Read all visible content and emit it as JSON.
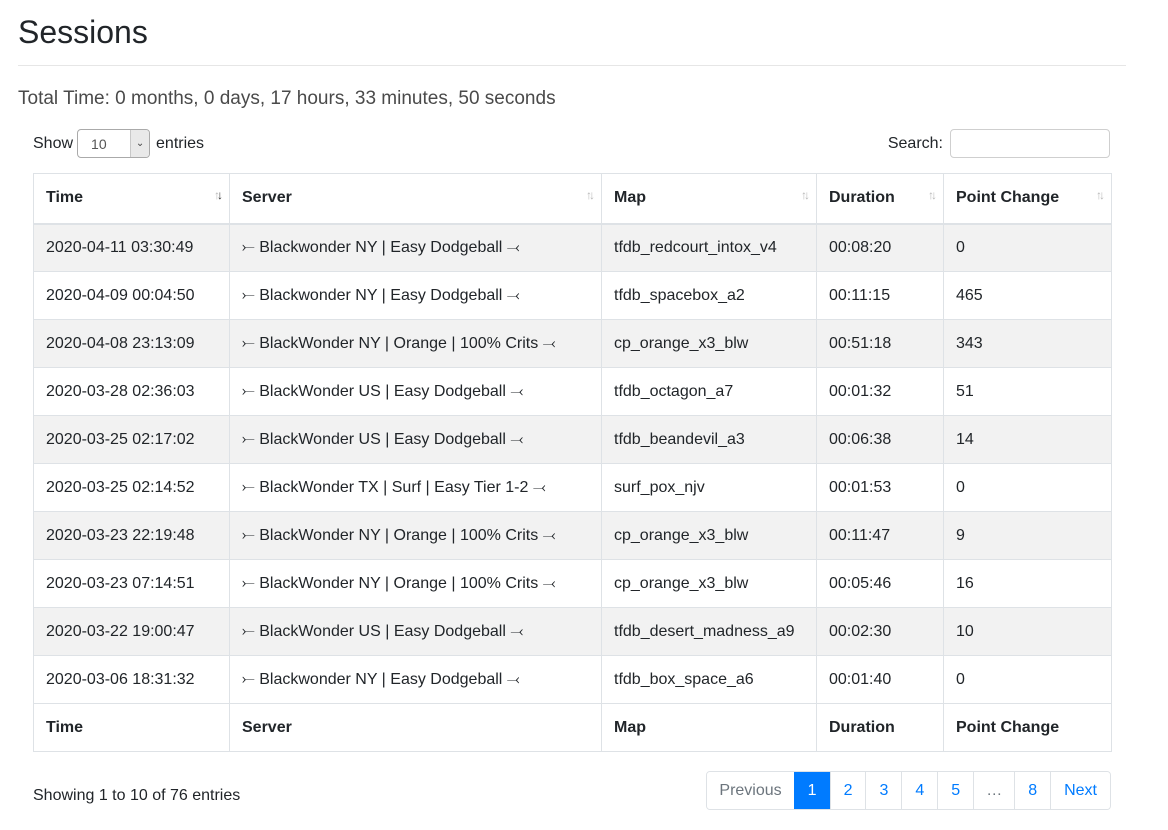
{
  "page": {
    "title": "Sessions",
    "total_time": "Total Time: 0 months, 0 days, 17 hours, 33 minutes, 50 seconds"
  },
  "length": {
    "show_label": "Show",
    "value": "10",
    "entries_label": "entries"
  },
  "search": {
    "label": "Search:",
    "value": ""
  },
  "table": {
    "columns": [
      "Time",
      "Server",
      "Map",
      "Duration",
      "Point Change"
    ],
    "rows": [
      [
        "2020-04-11 03:30:49",
        "⤚ Blackwonder NY | Easy Dodgeball ⤙",
        "tfdb_redcourt_intox_v4",
        "00:08:20",
        "0"
      ],
      [
        "2020-04-09 00:04:50",
        "⤚ Blackwonder NY | Easy Dodgeball ⤙",
        "tfdb_spacebox_a2",
        "00:11:15",
        "465"
      ],
      [
        "2020-04-08 23:13:09",
        "⤚ BlackWonder NY | Orange | 100% Crits ⤙",
        "cp_orange_x3_blw",
        "00:51:18",
        "343"
      ],
      [
        "2020-03-28 02:36:03",
        "⤚ BlackWonder US | Easy Dodgeball ⤙",
        "tfdb_octagon_a7",
        "00:01:32",
        "51"
      ],
      [
        "2020-03-25 02:17:02",
        "⤚ BlackWonder US | Easy Dodgeball ⤙",
        "tfdb_beandevil_a3",
        "00:06:38",
        "14"
      ],
      [
        "2020-03-25 02:14:52",
        "⤚ BlackWonder TX | Surf | Easy Tier 1-2 ⤙",
        "surf_pox_njv",
        "00:01:53",
        "0"
      ],
      [
        "2020-03-23 22:19:48",
        "⤚ BlackWonder NY | Orange | 100% Crits ⤙",
        "cp_orange_x3_blw",
        "00:11:47",
        "9"
      ],
      [
        "2020-03-23 07:14:51",
        "⤚ BlackWonder NY | Orange | 100% Crits ⤙",
        "cp_orange_x3_blw",
        "00:05:46",
        "16"
      ],
      [
        "2020-03-22 19:00:47",
        "⤚ BlackWonder US | Easy Dodgeball ⤙",
        "tfdb_desert_madness_a9",
        "00:02:30",
        "10"
      ],
      [
        "2020-03-06 18:31:32",
        "⤚ Blackwonder NY | Easy Dodgeball ⤙",
        "tfdb_box_space_a6",
        "00:01:40",
        "0"
      ]
    ],
    "sort_icons": "sort-arrows-icon"
  },
  "footer": {
    "info": "Showing 1 to 10 of 76 entries",
    "pagination": {
      "previous": "Previous",
      "pages": [
        "1",
        "2",
        "3",
        "4",
        "5",
        "…",
        "8"
      ],
      "active": "1",
      "next": "Next"
    }
  },
  "colors": {
    "accent": "#007bff",
    "stripe": "#f2f2f2",
    "border": "#dee2e6"
  }
}
